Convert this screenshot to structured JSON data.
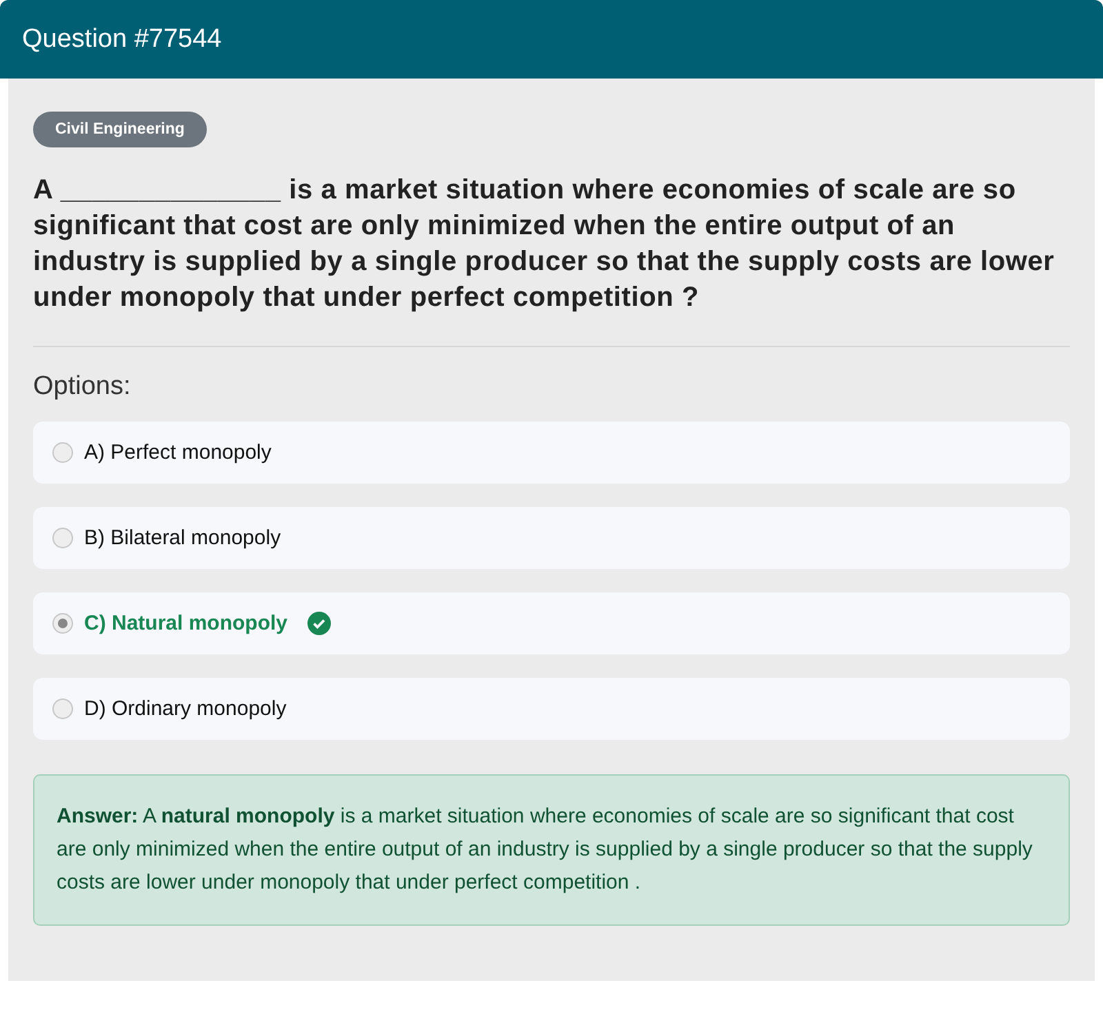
{
  "header": {
    "title": "Question #77544"
  },
  "category": "Civil Engineering",
  "question": "A ______________ is a market situation where economies of scale are so significant that cost are only minimized when the entire output of an industry is supplied by a single producer so that the supply costs are lower under monopoly that under perfect competition ?",
  "options_label": "Options:",
  "options": [
    {
      "label": "A) Perfect monopoly",
      "selected": false,
      "correct": false
    },
    {
      "label": "B) Bilateral monopoly",
      "selected": false,
      "correct": false
    },
    {
      "label": "C) Natural monopoly",
      "selected": true,
      "correct": true
    },
    {
      "label": "D) Ordinary monopoly",
      "selected": false,
      "correct": false
    }
  ],
  "answer": "**Answer:** A **natural monopoly** is a market situation where economies of scale are so significant that cost are only minimized when the entire output of an industry is supplied by a single producer so that the supply costs are lower under monopoly that under perfect competition ."
}
